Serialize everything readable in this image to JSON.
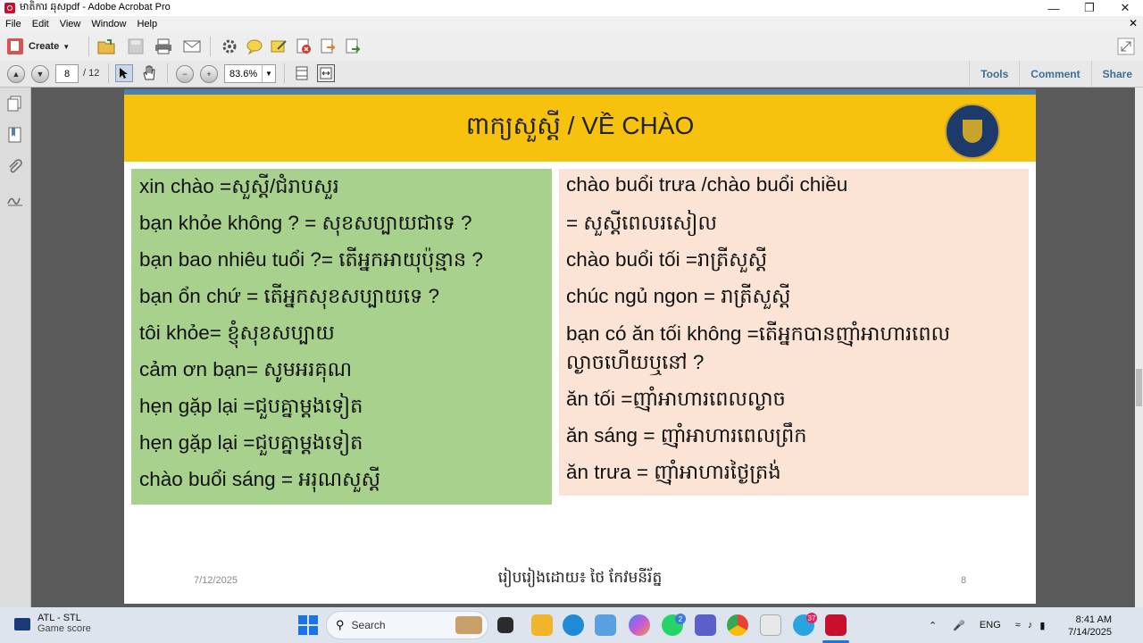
{
  "window": {
    "title": "មាតិការ ឆុសpdf - Adobe Acrobat Pro"
  },
  "menu": [
    "File",
    "Edit",
    "View",
    "Window",
    "Help"
  ],
  "toolbar": {
    "create_label": "Create",
    "icons": [
      "open-folder-icon",
      "save-icon",
      "print-icon",
      "email-icon",
      "settings-icon",
      "comment-icon",
      "highlight-icon",
      "delete-icon",
      "export-icon",
      "share-icon",
      "expand-icon"
    ]
  },
  "nav": {
    "current_page": "8",
    "total_pages": "/ 12",
    "zoom": "83.6%",
    "tools_label": "Tools",
    "comment_label": "Comment",
    "share_label": "Share"
  },
  "slide": {
    "title": "ពាក្យសួស្តី / VỀ CHÀO",
    "left_lines": [
      "xin chào        =សួស្តី/ជំរាបសួរ",
      "bạn khỏe không ? = សុខសប្បាយជាទេ ?",
      "bạn bao nhiêu tuổi ?= តើអ្នកអាយុប៉ុន្មាន ?",
      "bạn ổn chứ = តើអ្នកសុខសប្បាយទេ ?",
      "tôi khỏe= ខ្ញុំសុខសប្បាយ",
      "cảm ơn bạn= សូមអរគុណ",
      "hẹn gặp lại =ជួបគ្នាម្តងទៀត",
      "hẹn gặp lại    =ជួបគ្នាម្តងទៀត",
      "chào buổi sáng = អរុណសួស្តី"
    ],
    "right_lines": [
      "chào buổi trưa /chào buổi chiều",
      "= សួស្តីពេលរសៀល",
      "chào buổi tối =រាត្រីសួស្តី",
      "chúc ngủ ngon = រាត្រីសួស្តី",
      "bạn có ăn tối không =តើអ្នកបានញ៉ាំអាហារពេល",
      "ល្ងាចហើយឬនៅ ?",
      "ăn tối  =ញ៉ាំអាហារពេលល្ងាច",
      "ăn sáng = ញ៉ាំអាហារពេលព្រឹក",
      "ăn trưa = ញ៉ាំអាហារថ្ងៃត្រង់"
    ],
    "footer_date": "7/12/2025",
    "footer_credit": "រៀបរៀងដោយ៖ ថៃ កែវមនីរ័ត្ន",
    "footer_page": "8"
  },
  "taskbar": {
    "weather_line1": "ATL - STL",
    "weather_line2": "Game score",
    "search_placeholder": "Search",
    "language": "ENG",
    "time": "8:41 AM",
    "date": "7/14/2025",
    "badge_whatsapp": "2",
    "badge_telegram": "37"
  },
  "colors": {
    "header_yellow": "#f7c20d",
    "left_panel_green": "#a9d18e",
    "right_panel_peach": "#fbe4d5",
    "link_blue": "#3d6e93"
  }
}
